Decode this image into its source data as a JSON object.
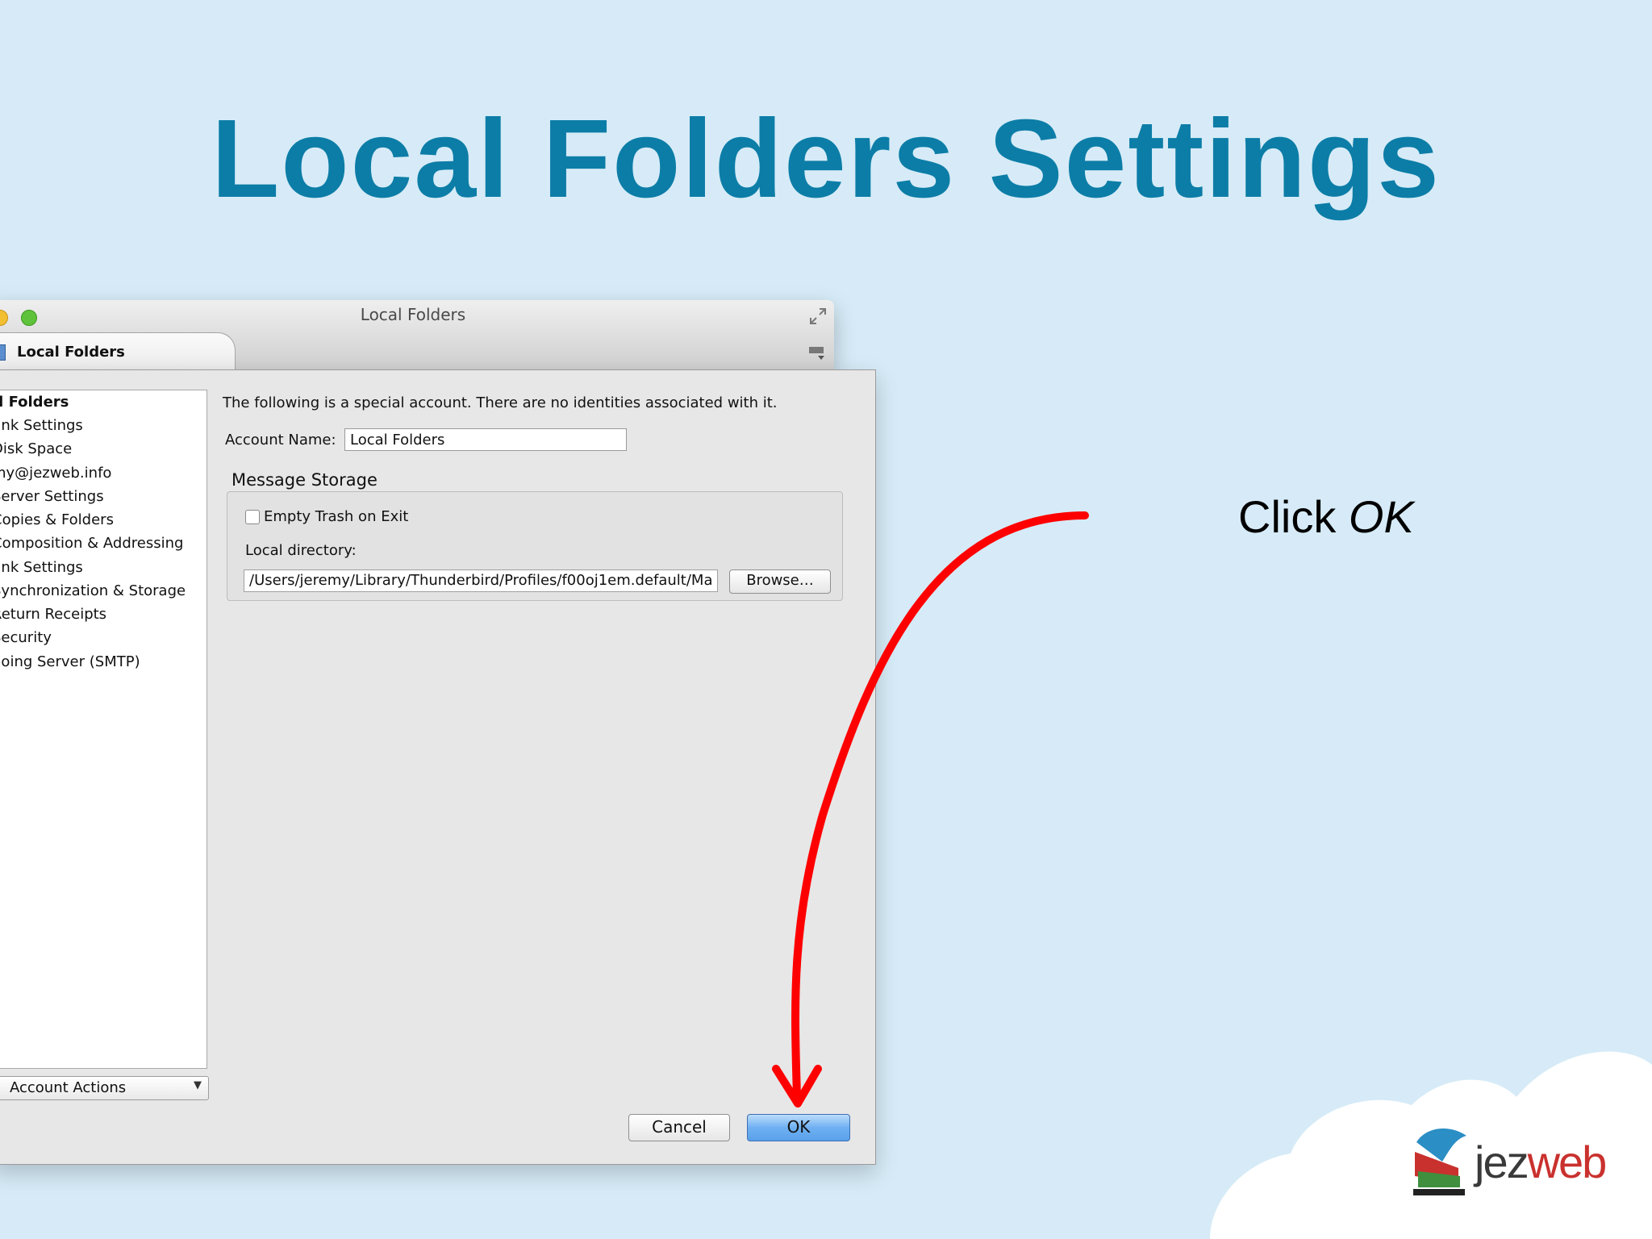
{
  "slide": {
    "title": "Local Folders Settings",
    "caption_prefix": "Click ",
    "caption_emphasis": "OK"
  },
  "window": {
    "title": "Local Folders",
    "tab_label": "Local Folders"
  },
  "sidebar": {
    "items": [
      {
        "label": "al Folders",
        "root": true
      },
      {
        "label": "unk Settings"
      },
      {
        "label": "Disk Space"
      },
      {
        "label": "my@jezweb.info"
      },
      {
        "label": "Server Settings"
      },
      {
        "label": "Copies & Folders"
      },
      {
        "label": "Composition & Addressing"
      },
      {
        "label": "unk Settings"
      },
      {
        "label": "Synchronization & Storage"
      },
      {
        "label": "Return Receipts"
      },
      {
        "label": "Security"
      },
      {
        "label": "going Server (SMTP)"
      }
    ],
    "account_actions": "Account Actions"
  },
  "main": {
    "special_text": "The following is a special account. There are no identities associated with it.",
    "account_name_label": "Account Name:",
    "account_name_value": "Local Folders",
    "storage_heading": "Message Storage",
    "empty_trash_label": "Empty Trash on Exit",
    "empty_trash_checked": false,
    "local_directory_label": "Local directory:",
    "local_directory_value": "/Users/jeremy/Library/Thunderbird/Profiles/f00oj1em.default/Ma",
    "browse_label": "Browse…"
  },
  "buttons": {
    "cancel": "Cancel",
    "ok": "OK"
  },
  "logo": {
    "text_dark": "jez",
    "text_red": "web"
  },
  "colors": {
    "background": "#d6ebf7",
    "title": "#0c7da7",
    "arrow": "#ff0000",
    "ok_button": "#6fb0f2"
  }
}
